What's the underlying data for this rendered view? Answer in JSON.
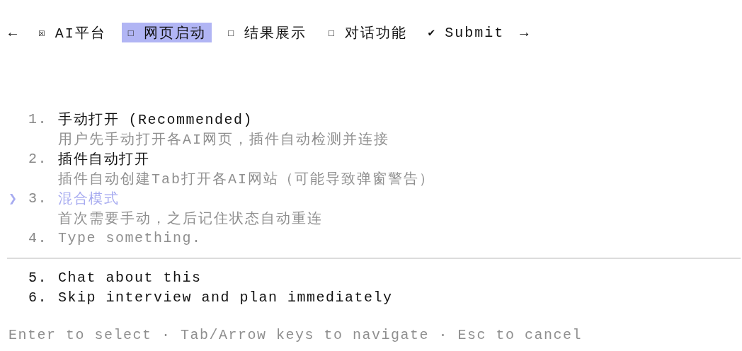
{
  "nav": {
    "back": "←",
    "forward": "→"
  },
  "tabs": [
    {
      "kind": "step",
      "glyph": "☒",
      "label": "AI平台",
      "checked": true,
      "selected": false
    },
    {
      "kind": "step",
      "glyph": "☐",
      "label": "网页启动",
      "checked": false,
      "selected": true
    },
    {
      "kind": "step",
      "glyph": "☐",
      "label": "结果展示",
      "checked": false,
      "selected": false
    },
    {
      "kind": "step",
      "glyph": "☐",
      "label": "对话功能",
      "checked": false,
      "selected": false
    },
    {
      "kind": "submit",
      "glyph": "✔",
      "label": "Submit",
      "selected": false
    }
  ],
  "options": [
    {
      "kind": "choice",
      "number": "1.",
      "label": "手动打开 (Recommended)",
      "description": "用户先手动打开各AI网页，插件自动检测并连接",
      "selected": false
    },
    {
      "kind": "choice",
      "number": "2.",
      "label": "插件自动打开",
      "description": "插件自动创建Tab打开各AI网站（可能导致弹窗警告）",
      "selected": false
    },
    {
      "kind": "choice",
      "number": "3.",
      "label": "混合模式",
      "description": "首次需要手动，之后记住状态自动重连",
      "selected": true
    },
    {
      "kind": "input",
      "number": "4.",
      "placeholder": "Type something.",
      "selected": false
    }
  ],
  "cursor": "❯",
  "extra_options": [
    {
      "number": "5.",
      "label": "Chat about this"
    },
    {
      "number": "6.",
      "label": "Skip interview and plan immediately"
    }
  ],
  "footer": "Enter to select · Tab/Arrow keys to navigate · Esc to cancel"
}
